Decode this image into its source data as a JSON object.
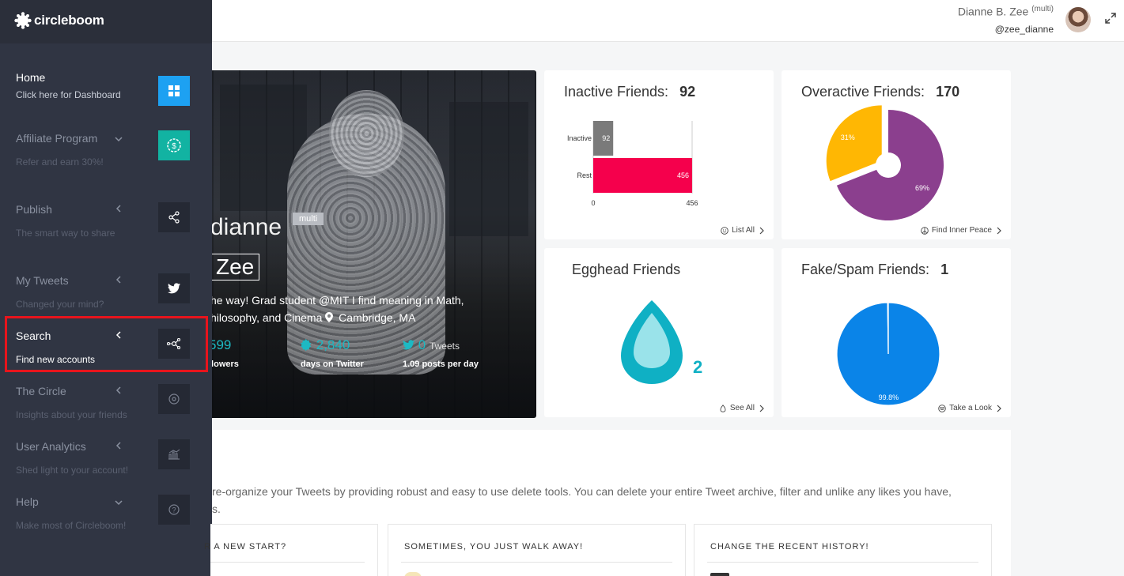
{
  "header": {
    "user_name": "Dianne B. Zee",
    "user_badge": "(multi)",
    "user_handle": "@zee_dianne"
  },
  "sidebar": {
    "logo_text": "circleboom",
    "items": [
      {
        "label": "Home",
        "sub": "Click here for Dashboard",
        "icon": "dashboard-grid-icon"
      },
      {
        "label": "Affiliate Program",
        "sub": "Refer and earn 30%!",
        "icon": "dollar-badge-icon"
      },
      {
        "label": "Publish",
        "sub": "The smart way to share",
        "icon": "share-icon"
      },
      {
        "label": "My Tweets",
        "sub": "Changed your mind?",
        "icon": "twitter-bird-icon"
      },
      {
        "label": "Search",
        "sub": "Find new accounts",
        "icon": "network-search-icon"
      },
      {
        "label": "The Circle",
        "sub": "Insights about your friends",
        "icon": "target-circle-icon"
      },
      {
        "label": "User Analytics",
        "sub": "Shed light to your account!",
        "icon": "bar-chart-icon"
      },
      {
        "label": "Help",
        "sub": "Make most of Circleboom!",
        "icon": "question-circle-icon"
      }
    ]
  },
  "profile": {
    "first_name": "dianne",
    "tag": "multi",
    "last_name": "Zee",
    "bio_line1": "he way! Grad student @MIT I find meaning in Math,",
    "bio_line2": "hilosophy, and Cinema",
    "location": "Cambridge, MA",
    "stats": [
      {
        "value": "599",
        "unit": "",
        "label": "llowers"
      },
      {
        "value": "2,840",
        "unit": "",
        "label": "days on Twitter"
      },
      {
        "value": "0",
        "unit": "Tweets",
        "label": "1.09 posts per day"
      }
    ]
  },
  "inactive_card": {
    "title": "Inactive Friends:",
    "count": "92",
    "link": "List All",
    "chart_data": {
      "type": "bar",
      "categories": [
        "Inactive",
        "Rest"
      ],
      "values": [
        92,
        456
      ],
      "xlim": [
        0,
        456
      ],
      "tick_labels": [
        "0",
        "456"
      ],
      "colors": [
        "#7a7a7a",
        "#f5004c"
      ]
    }
  },
  "overactive_card": {
    "title": "Overactive Friends:",
    "count": "170",
    "link": "Find Inner Peace",
    "chart_data": {
      "type": "pie",
      "labels": [
        "31%",
        "69%"
      ],
      "values": [
        31,
        69
      ],
      "colors": [
        "#ffb703",
        "#8b3f8e"
      ]
    }
  },
  "egghead_card": {
    "title": "Egghead Friends",
    "count": "2",
    "link": "See All"
  },
  "fake_card": {
    "title": "Fake/Spam Friends:",
    "count": "1",
    "link": "Take a Look",
    "chart_data": {
      "type": "pie",
      "labels": [
        "99.8%"
      ],
      "values": [
        99.8,
        0.2
      ],
      "colors": [
        "#0a84e8",
        "#ffffff"
      ]
    }
  },
  "tweets_section": {
    "description": "re-organize your Tweets by providing robust and easy to use delete tools. You can delete your entire Tweet archive, filter and unlike any likes you have,\ns.",
    "cards": [
      {
        "title": "R A NEW START?"
      },
      {
        "title": "SOMETIMES, YOU JUST WALK AWAY!"
      },
      {
        "title": "CHANGE THE RECENT HISTORY!"
      }
    ]
  },
  "colors": {
    "sidebar_bg": "#303543",
    "accent_teal": "#1db9c3",
    "highlight_red": "#e8141c"
  }
}
